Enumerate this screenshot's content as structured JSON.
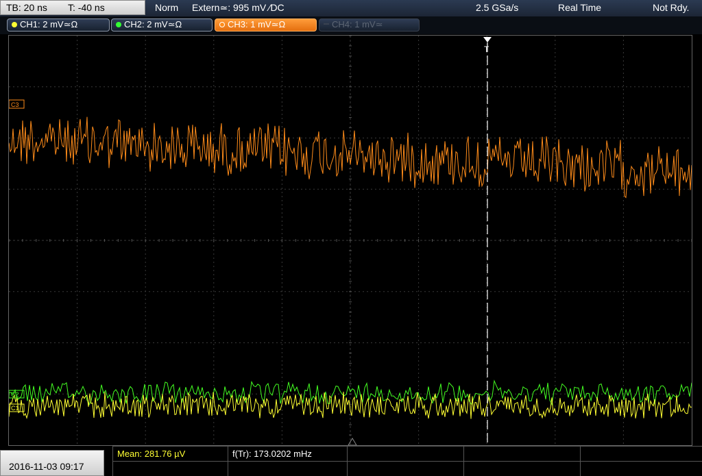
{
  "timebase": {
    "tb": "TB: 20 ns",
    "t": "T: -40 ns"
  },
  "status": {
    "mode": "Norm",
    "trigger": "Extern≃: 995 mV ∕DC",
    "sample_rate": "2.5 GSa/s",
    "acq": "Real Time",
    "ready": "Not Rdy."
  },
  "channels": [
    {
      "label": "CH1: 2 mV≃Ω",
      "color": "#ffff33",
      "state": "on"
    },
    {
      "label": "CH2: 2 mV≃Ω",
      "color": "#33ff33",
      "state": "on"
    },
    {
      "label": "CH3: 1 mV≃Ω",
      "color": "#ff8c1a",
      "state": "active"
    },
    {
      "label": "CH4: 1 mV≃",
      "color": "#5d6674",
      "state": "off"
    }
  ],
  "markers": {
    "ch3": "C3",
    "ch2": "C2",
    "ch1": "C1",
    "trigger": "T"
  },
  "measurements": {
    "mean": "Mean: 281.76 µV",
    "freq": "f(Tr): 173.0202 mHz"
  },
  "datetime": "2016-11-03 09:17",
  "traces": {
    "ch3_color": "#ff8c1a",
    "ch2_color": "#44ff22",
    "ch1_color": "#ffff33"
  }
}
